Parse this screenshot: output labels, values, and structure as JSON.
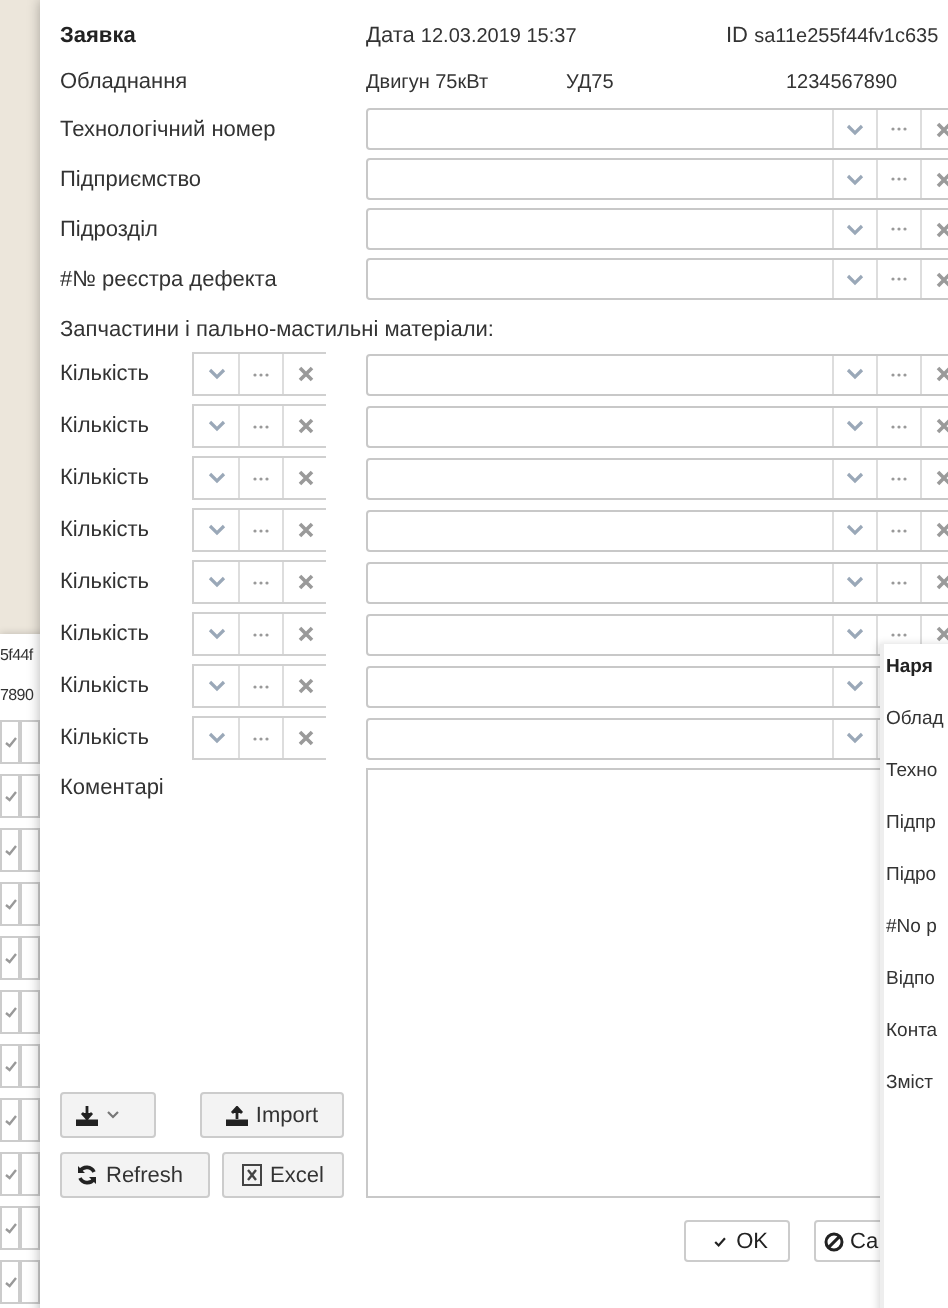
{
  "left_window": {
    "texts": [
      "5f44f",
      "7890"
    ]
  },
  "main_window": {
    "title": "Заявка",
    "date_label": "Дата",
    "date": "12.03.2019 15:37",
    "id_label": "ID",
    "id": "sa11e255f44fv1c635",
    "equipment": {
      "label": "Обладнання",
      "name": "Двигун 75кВт",
      "model": "УД75",
      "number": "1234567890"
    },
    "fields": [
      {
        "label": "Технологічний номер"
      },
      {
        "label": "Підприємство"
      },
      {
        "label": "Підрозділ"
      },
      {
        "label": "#№ реєстра дефекта"
      }
    ],
    "parts_heading": "Запчастини і пально-мастильні матеріали:",
    "parts": [
      {
        "label": "Кількість"
      },
      {
        "label": "Кількість"
      },
      {
        "label": "Кількість"
      },
      {
        "label": "Кількість"
      },
      {
        "label": "Кількість"
      },
      {
        "label": "Кількість"
      },
      {
        "label": "Кількість"
      },
      {
        "label": "Кількість"
      }
    ],
    "comment_label": "Коментарі",
    "tool_buttons": [
      {
        "kind": "download"
      },
      {
        "kind": "import",
        "label": "Import"
      },
      {
        "kind": "refresh",
        "label": "Refresh"
      },
      {
        "kind": "excel",
        "label": "Excel"
      }
    ],
    "dialog_buttons": [
      {
        "kind": "ok",
        "label": "OK"
      },
      {
        "kind": "cancel",
        "label": "Ca"
      }
    ]
  },
  "right_window": {
    "title": "Наря",
    "labels": [
      "Облад",
      "Техно",
      "Підпр",
      "Підро",
      "#No р",
      "Відпо",
      "Конта",
      "Зміст"
    ]
  }
}
